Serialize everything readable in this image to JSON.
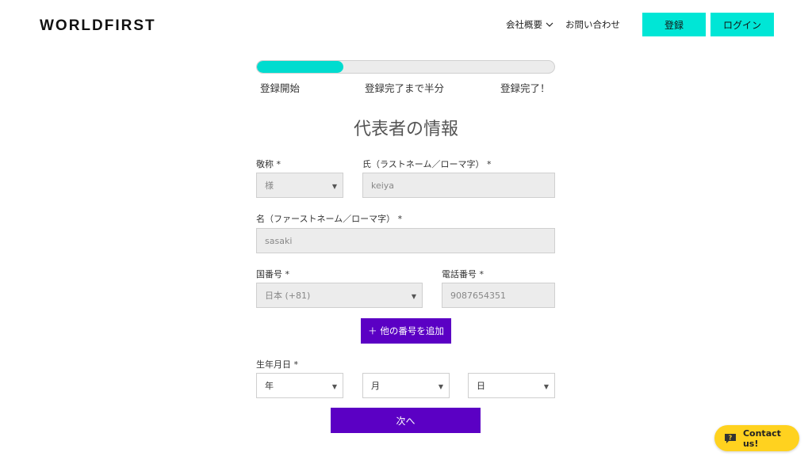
{
  "header": {
    "logo": "WORLDFIRST",
    "nav": {
      "about": "会社概要",
      "contact": "お問い合わせ",
      "register": "登録",
      "login": "ログイン"
    }
  },
  "progress": {
    "percent": 29,
    "steps": [
      "登録開始",
      "登録完了まで半分",
      "登録完了！"
    ]
  },
  "form": {
    "title": "代表者の情報",
    "honorific": {
      "label": "敬称 *",
      "value": "様"
    },
    "last_name": {
      "label": "氏（ラストネーム／ローマ字） *",
      "value": "keiya"
    },
    "first_name": {
      "label": "名（ファーストネーム／ローマ字） *",
      "value": "sasaki"
    },
    "country_code": {
      "label": "国番号 *",
      "value": "日本 (+81)"
    },
    "phone": {
      "label": "電話番号 *",
      "value": "9087654351"
    },
    "add_number": "＋ 他の番号を追加",
    "birthday": {
      "label": "生年月日 *",
      "year": "年",
      "month": "月",
      "day": "日"
    },
    "next": "次へ"
  },
  "chat": {
    "label": "Contact us!"
  },
  "colors": {
    "teal": "#00e6d6",
    "purple": "#5b00c4",
    "yellow": "#ffd21f"
  }
}
